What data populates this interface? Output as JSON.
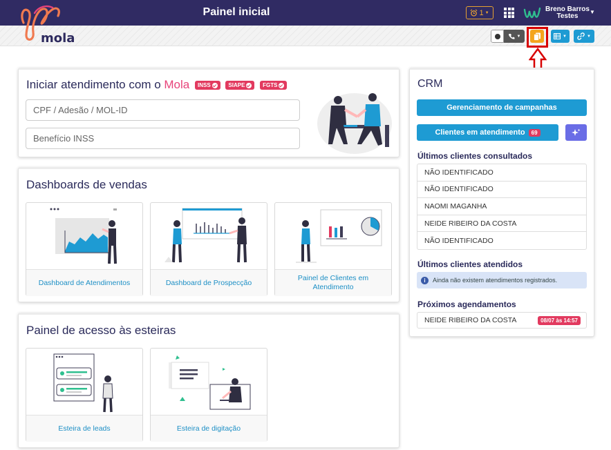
{
  "header": {
    "title": "Painel inicial",
    "alert_count": "1",
    "user_name": "Breno Barros",
    "user_org": "Testes"
  },
  "brand": {
    "logo_text": "mola",
    "accent": "#e8437a"
  },
  "start": {
    "title_prefix": "Iniciar atendimento com o",
    "title_brand": "Mola",
    "badges": [
      "INSS",
      "SIAPE",
      "FGTS"
    ],
    "input_cpf_placeholder": "CPF / Adesão / MOL-ID",
    "input_beneficio_placeholder": "Benefício INSS"
  },
  "dashboards": {
    "title": "Dashboards de vendas",
    "tiles": [
      "Dashboard de Atendimentos",
      "Dashboard de Prospecção",
      "Painel de Clientes em Atendimento"
    ]
  },
  "esteiras": {
    "title": "Painel de acesso às esteiras",
    "tiles": [
      "Esteira de leads",
      "Esteira de digitação"
    ]
  },
  "crm": {
    "title": "CRM",
    "campaigns_label": "Gerenciamento de campanhas",
    "clients_label": "Clientes em atendimento",
    "clients_count": "69",
    "recent_title": "Últimos clientes consultados",
    "recent": [
      "NÃO IDENTIFICADO",
      "NÃO IDENTIFICADO",
      "NAOMI MAGANHA",
      "NEIDE RIBEIRO DA COSTA",
      "NÃO IDENTIFICADO"
    ],
    "attended_title": "Últimos clientes atendidos",
    "attended_empty": "Ainda não existem atendimentos registrados.",
    "schedule_title": "Próximos agendamentos",
    "schedule_name": "NEIDE RIBEIRO DA COSTA",
    "schedule_time": "08/07 às 14:57"
  },
  "colors": {
    "topbar": "#302b63",
    "primary": "#1e9bd3",
    "danger": "#e23a5f",
    "highlight": "#d80000",
    "orange": "#f4a51c"
  },
  "icons": [
    "alarm-icon",
    "apps-grid-icon",
    "user-logo-icon",
    "record-icon",
    "phone-icon",
    "document-icon",
    "table-icon",
    "link-icon",
    "sparkle-icon",
    "info-icon",
    "check-icon",
    "arrow-up-icon"
  ]
}
